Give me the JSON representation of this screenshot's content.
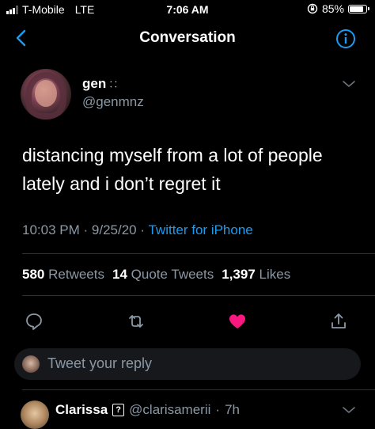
{
  "status_bar": {
    "carrier": "T-Mobile",
    "network": "LTE",
    "time": "7:06 AM",
    "battery": "85%",
    "battery_level": 0.85
  },
  "nav": {
    "title": "Conversation",
    "back_icon": "chevron-left-icon",
    "info_icon": "info-icon"
  },
  "tweet": {
    "author_name": "gen",
    "author_name_glyph": "⸬",
    "author_handle": "@genmnz",
    "text": "distancing myself from a lot of people lately and i don’t regret it",
    "time": "10:03 PM",
    "date": "9/25/20",
    "separator": "·",
    "source": "Twitter for iPhone",
    "stats": {
      "retweets_count": "580",
      "retweets_label": "Retweets",
      "quote_count": "14",
      "quote_label": "Quote Tweets",
      "likes_count": "1,397",
      "likes_label": "Likes"
    }
  },
  "actions": {
    "reply_icon": "comment-icon",
    "retweet_icon": "retweet-icon",
    "like_icon": "heart-icon",
    "share_icon": "share-icon",
    "like_color": "#f91880"
  },
  "reply_box": {
    "placeholder": "Tweet your reply"
  },
  "next_reply": {
    "name": "Clarissa",
    "badge": "?",
    "handle": "@clarisamerii",
    "time": "7h"
  },
  "colors": {
    "accent": "#1d9bf0",
    "muted": "#8b98a5",
    "background": "#000000"
  }
}
